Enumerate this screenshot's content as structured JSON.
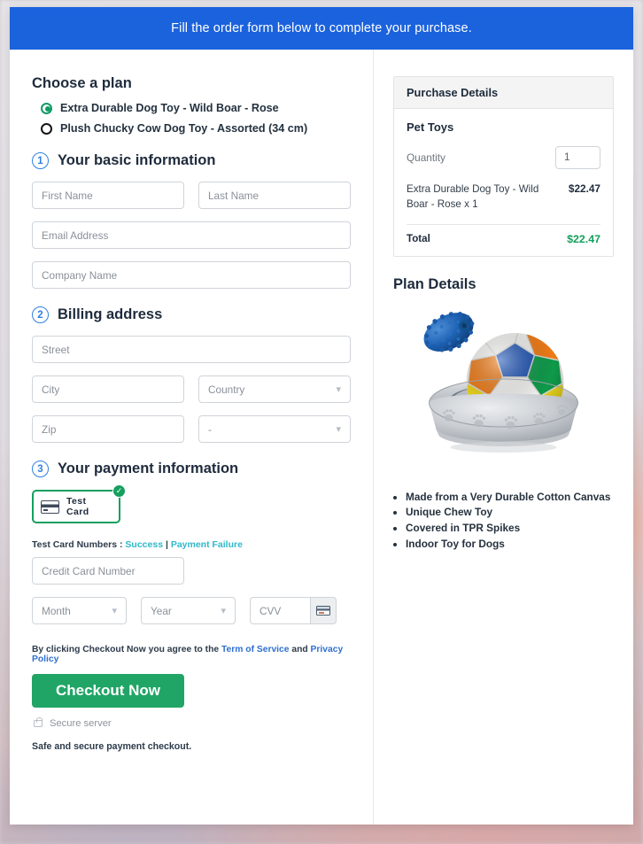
{
  "banner": {
    "text": "Fill the order form below to complete your purchase."
  },
  "plan": {
    "heading": "Choose a plan",
    "options": [
      {
        "label": "Extra Durable Dog Toy - Wild Boar - Rose",
        "selected": true
      },
      {
        "label": "Plush Chucky Cow Dog Toy - Assorted (34 cm)",
        "selected": false
      }
    ]
  },
  "steps": {
    "basic": {
      "num": "1",
      "title": "Your basic information"
    },
    "billing": {
      "num": "2",
      "title": "Billing address"
    },
    "payment": {
      "num": "3",
      "title": "Your payment information"
    }
  },
  "fields": {
    "first_name": "First Name",
    "last_name": "Last Name",
    "email": "Email Address",
    "company": "Company Name",
    "street": "Street",
    "city": "City",
    "country": "Country",
    "zip": "Zip",
    "state": "-",
    "credit_card": "Credit Card Number",
    "month": "Month",
    "year": "Year",
    "cvv": "CVV"
  },
  "payment": {
    "tile_label": "Test  Card",
    "test_numbers_prefix": "Test Card Numbers : ",
    "link_success": "Success",
    "link_separator": " | ",
    "link_failure": "Payment Failure",
    "terms_prefix": "By clicking Checkout Now you agree to the ",
    "terms_link": "Term of Service",
    "terms_and": " and ",
    "privacy_link": "Privacy Policy",
    "checkout_label": "Checkout Now",
    "secure_server": "Secure server",
    "safe_text": "Safe and secure payment checkout."
  },
  "purchase": {
    "header": "Purchase Details",
    "category": "Pet Toys",
    "quantity_label": "Quantity",
    "quantity_value": "1",
    "item_name": "Extra Durable Dog Toy - Wild Boar - Rose x 1",
    "item_price": "$22.47",
    "total_label": "Total",
    "total_value": "$22.47"
  },
  "plan_details": {
    "heading": "Plan Details",
    "image_alt": "pet-toys-product-photo",
    "bullets": [
      "Made from a Very Durable Cotton Canvas",
      "Unique Chew Toy",
      "Covered in TPR Spikes",
      "Indoor Toy for Dogs"
    ]
  },
  "colors": {
    "banner_blue": "#1b62dd",
    "accent_green": "#21a566",
    "total_green": "#14a05c",
    "link_teal": "#2fb8c9",
    "link_blue": "#2f6fd0",
    "step_blue": "#2f7fe4"
  }
}
